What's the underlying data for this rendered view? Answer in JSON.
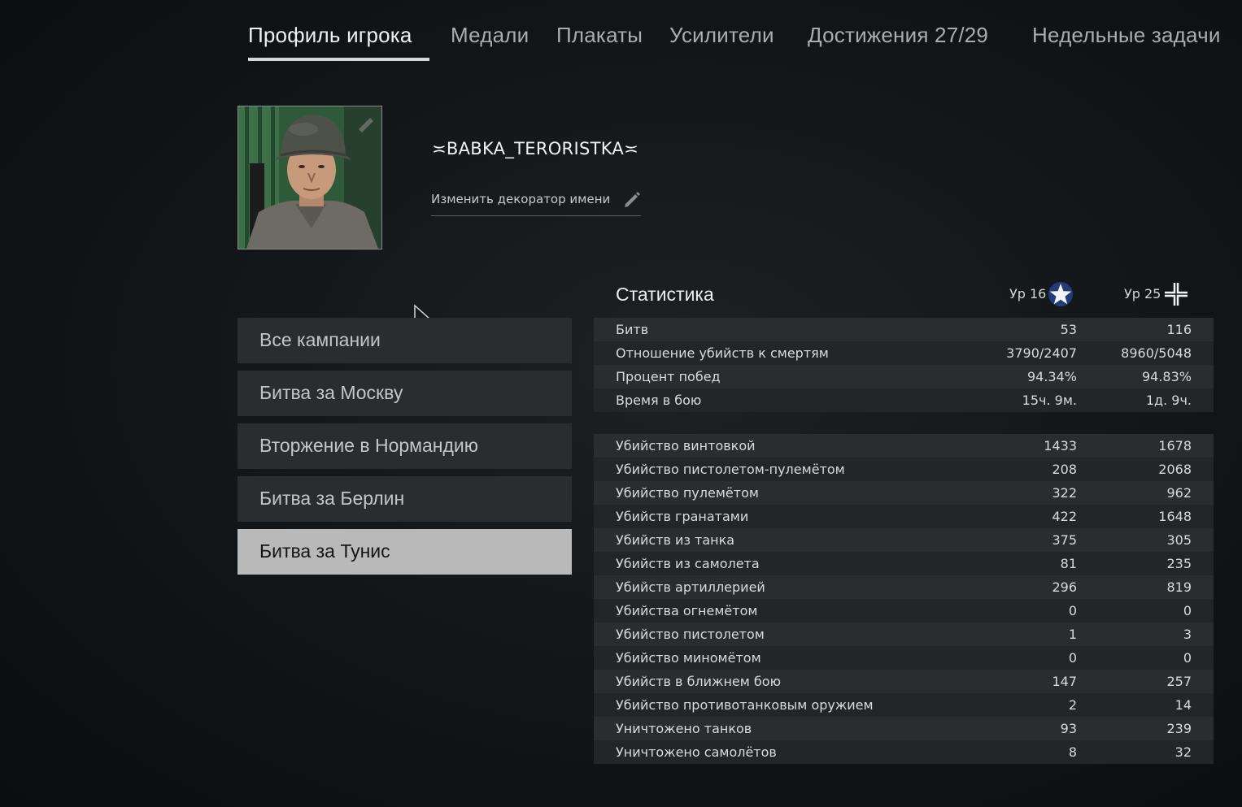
{
  "tabs": [
    {
      "label": "Профиль игрока",
      "active": true
    },
    {
      "label": "Медали",
      "active": false
    },
    {
      "label": "Плакаты",
      "active": false
    },
    {
      "label": "Усилители",
      "active": false
    },
    {
      "label": "Достижения 27/29",
      "active": false
    },
    {
      "label": "Недельные задачи",
      "active": false
    }
  ],
  "profile": {
    "name": "≍BABKA_TERORISTKA≍",
    "change_decorator": "Изменить декоратор имени"
  },
  "campaigns": [
    {
      "label": "Все кампании",
      "selected": false
    },
    {
      "label": "Битва за Москву",
      "selected": false
    },
    {
      "label": "Вторжение в Нормандию",
      "selected": false
    },
    {
      "label": "Битва за Берлин",
      "selected": false
    },
    {
      "label": "Битва за Тунис",
      "selected": true
    }
  ],
  "stats": {
    "title": "Статистика",
    "col1": {
      "label": "Ур 16",
      "icon": "allies-star-icon"
    },
    "col2": {
      "label": "Ур 25",
      "icon": "axis-cross-icon"
    },
    "summary": [
      {
        "label": "Битв",
        "v1": "53",
        "v2": "116"
      },
      {
        "label": "Отношение убийств к смертям",
        "v1": "3790/2407",
        "v2": "8960/5048"
      },
      {
        "label": "Процент побед",
        "v1": "94.34%",
        "v2": "94.83%"
      },
      {
        "label": "Время в бою",
        "v1": "15ч. 9м.",
        "v2": "1д. 9ч."
      }
    ],
    "details": [
      {
        "label": "Убийство винтовкой",
        "v1": "1433",
        "v2": "1678"
      },
      {
        "label": "Убийство пистолетом-пулемётом",
        "v1": "208",
        "v2": "2068"
      },
      {
        "label": "Убийство пулемётом",
        "v1": "322",
        "v2": "962"
      },
      {
        "label": "Убийств гранатами",
        "v1": "422",
        "v2": "1648"
      },
      {
        "label": "Убийств из танка",
        "v1": "375",
        "v2": "305"
      },
      {
        "label": "Убийств из самолета",
        "v1": "81",
        "v2": "235"
      },
      {
        "label": "Убийств артиллерией",
        "v1": "296",
        "v2": "819"
      },
      {
        "label": "Убийства огнемётом",
        "v1": "0",
        "v2": "0"
      },
      {
        "label": "Убийство пистолетом",
        "v1": "1",
        "v2": "3"
      },
      {
        "label": "Убийство миномётом",
        "v1": "0",
        "v2": "0"
      },
      {
        "label": "Убийств в ближнем бою",
        "v1": "147",
        "v2": "257"
      },
      {
        "label": "Убийство противотанковым оружием",
        "v1": "2",
        "v2": "14"
      },
      {
        "label": "Уничтожено танков",
        "v1": "93",
        "v2": "239"
      },
      {
        "label": "Уничтожено самолётов",
        "v1": "8",
        "v2": "32"
      }
    ]
  }
}
